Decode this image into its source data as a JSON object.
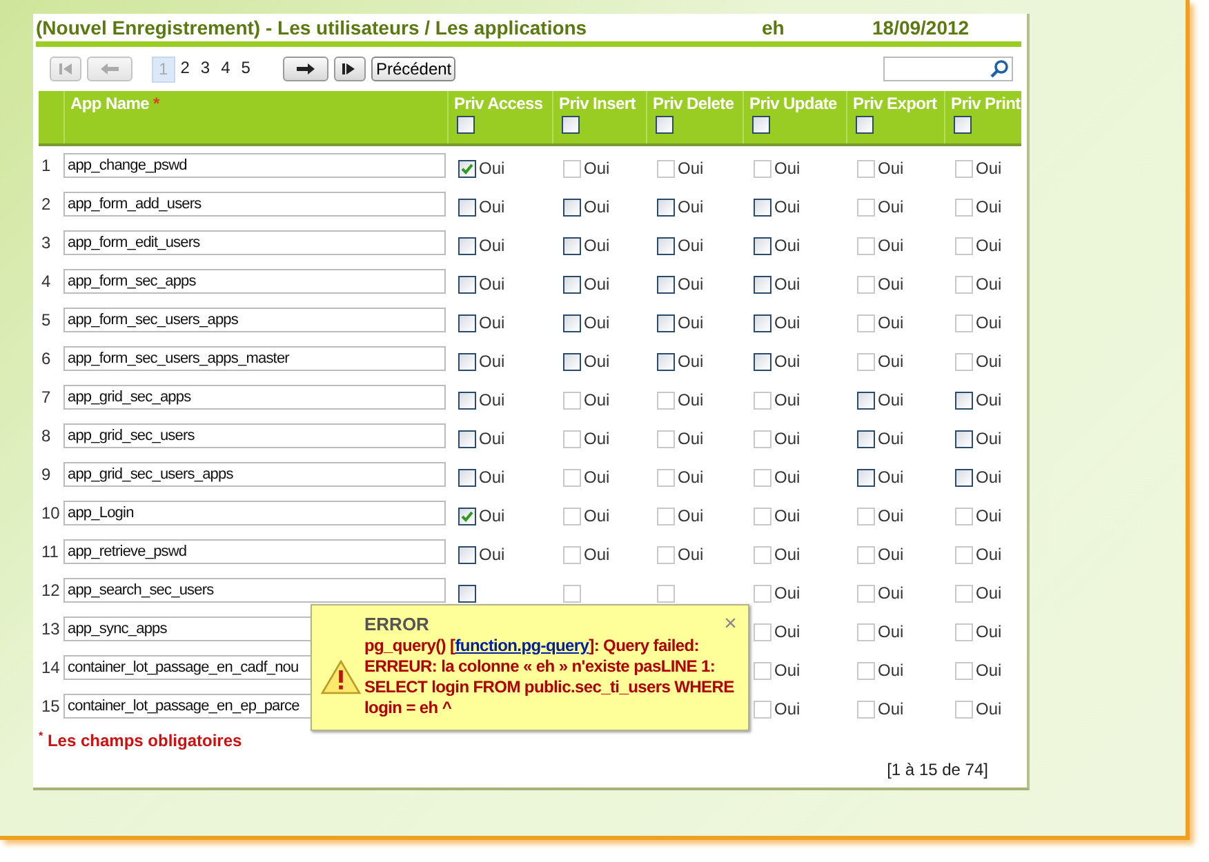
{
  "header": {
    "title": "(Nouvel Enregistrement) - Les utilisateurs / Les applications",
    "user": "eh",
    "date": "18/09/2012"
  },
  "pager": {
    "nav": [
      {
        "kind": "first",
        "disabled": true
      },
      {
        "kind": "prev",
        "disabled": true
      },
      {
        "kind": "pages"
      },
      {
        "kind": "next",
        "disabled": false
      },
      {
        "kind": "last",
        "disabled": false
      },
      {
        "kind": "back",
        "label": "Précédent"
      }
    ],
    "pages": [
      {
        "label": "1",
        "selected": true
      },
      {
        "label": "2",
        "selected": false
      },
      {
        "label": "3",
        "selected": false
      },
      {
        "label": "4",
        "selected": false
      },
      {
        "label": "5",
        "selected": false
      }
    ]
  },
  "table": {
    "columns": [
      {
        "label": "App Name",
        "marker": "*"
      },
      {
        "label": "Priv Access"
      },
      {
        "label": "Priv Insert"
      },
      {
        "label": "Priv Delete"
      },
      {
        "label": "Priv Update"
      },
      {
        "label": "Priv Export"
      },
      {
        "label": "Priv Print"
      }
    ],
    "header_checks": [
      {
        "checked": false
      },
      {
        "checked": false
      },
      {
        "checked": false
      },
      {
        "checked": false
      },
      {
        "checked": false
      },
      {
        "checked": false
      }
    ],
    "rows": [
      {
        "num": "1",
        "name": "app_change_pswd",
        "privs": [
          {
            "label": "Oui",
            "checked": true,
            "disabled": false
          },
          {
            "label": "Oui",
            "checked": false,
            "disabled": true
          },
          {
            "label": "Oui",
            "checked": false,
            "disabled": true
          },
          {
            "label": "Oui",
            "checked": false,
            "disabled": true
          },
          {
            "label": "Oui",
            "checked": false,
            "disabled": true
          },
          {
            "label": "Oui",
            "checked": false,
            "disabled": true
          }
        ]
      },
      {
        "num": "2",
        "name": "app_form_add_users",
        "privs": [
          {
            "label": "Oui",
            "checked": false,
            "disabled": false
          },
          {
            "label": "Oui",
            "checked": false,
            "disabled": false
          },
          {
            "label": "Oui",
            "checked": false,
            "disabled": false
          },
          {
            "label": "Oui",
            "checked": false,
            "disabled": false
          },
          {
            "label": "Oui",
            "checked": false,
            "disabled": true
          },
          {
            "label": "Oui",
            "checked": false,
            "disabled": true
          }
        ]
      },
      {
        "num": "3",
        "name": "app_form_edit_users",
        "privs": [
          {
            "label": "Oui",
            "checked": false,
            "disabled": false
          },
          {
            "label": "Oui",
            "checked": false,
            "disabled": false
          },
          {
            "label": "Oui",
            "checked": false,
            "disabled": false
          },
          {
            "label": "Oui",
            "checked": false,
            "disabled": false
          },
          {
            "label": "Oui",
            "checked": false,
            "disabled": true
          },
          {
            "label": "Oui",
            "checked": false,
            "disabled": true
          }
        ]
      },
      {
        "num": "4",
        "name": "app_form_sec_apps",
        "privs": [
          {
            "label": "Oui",
            "checked": false,
            "disabled": false
          },
          {
            "label": "Oui",
            "checked": false,
            "disabled": false
          },
          {
            "label": "Oui",
            "checked": false,
            "disabled": false
          },
          {
            "label": "Oui",
            "checked": false,
            "disabled": false
          },
          {
            "label": "Oui",
            "checked": false,
            "disabled": true
          },
          {
            "label": "Oui",
            "checked": false,
            "disabled": true
          }
        ]
      },
      {
        "num": "5",
        "name": "app_form_sec_users_apps",
        "privs": [
          {
            "label": "Oui",
            "checked": false,
            "disabled": false
          },
          {
            "label": "Oui",
            "checked": false,
            "disabled": false
          },
          {
            "label": "Oui",
            "checked": false,
            "disabled": false
          },
          {
            "label": "Oui",
            "checked": false,
            "disabled": false
          },
          {
            "label": "Oui",
            "checked": false,
            "disabled": true
          },
          {
            "label": "Oui",
            "checked": false,
            "disabled": true
          }
        ]
      },
      {
        "num": "6",
        "name": "app_form_sec_users_apps_master",
        "privs": [
          {
            "label": "Oui",
            "checked": false,
            "disabled": false
          },
          {
            "label": "Oui",
            "checked": false,
            "disabled": false
          },
          {
            "label": "Oui",
            "checked": false,
            "disabled": false
          },
          {
            "label": "Oui",
            "checked": false,
            "disabled": false
          },
          {
            "label": "Oui",
            "checked": false,
            "disabled": true
          },
          {
            "label": "Oui",
            "checked": false,
            "disabled": true
          }
        ]
      },
      {
        "num": "7",
        "name": "app_grid_sec_apps",
        "privs": [
          {
            "label": "Oui",
            "checked": false,
            "disabled": false
          },
          {
            "label": "Oui",
            "checked": false,
            "disabled": true
          },
          {
            "label": "Oui",
            "checked": false,
            "disabled": true
          },
          {
            "label": "Oui",
            "checked": false,
            "disabled": true
          },
          {
            "label": "Oui",
            "checked": false,
            "disabled": false
          },
          {
            "label": "Oui",
            "checked": false,
            "disabled": false
          }
        ]
      },
      {
        "num": "8",
        "name": "app_grid_sec_users",
        "privs": [
          {
            "label": "Oui",
            "checked": false,
            "disabled": false
          },
          {
            "label": "Oui",
            "checked": false,
            "disabled": true
          },
          {
            "label": "Oui",
            "checked": false,
            "disabled": true
          },
          {
            "label": "Oui",
            "checked": false,
            "disabled": true
          },
          {
            "label": "Oui",
            "checked": false,
            "disabled": false
          },
          {
            "label": "Oui",
            "checked": false,
            "disabled": false
          }
        ]
      },
      {
        "num": "9",
        "name": "app_grid_sec_users_apps",
        "privs": [
          {
            "label": "Oui",
            "checked": false,
            "disabled": false
          },
          {
            "label": "Oui",
            "checked": false,
            "disabled": true
          },
          {
            "label": "Oui",
            "checked": false,
            "disabled": true
          },
          {
            "label": "Oui",
            "checked": false,
            "disabled": true
          },
          {
            "label": "Oui",
            "checked": false,
            "disabled": false
          },
          {
            "label": "Oui",
            "checked": false,
            "disabled": false
          }
        ]
      },
      {
        "num": "10",
        "name": "app_Login",
        "privs": [
          {
            "label": "Oui",
            "checked": true,
            "disabled": false
          },
          {
            "label": "Oui",
            "checked": false,
            "disabled": true
          },
          {
            "label": "Oui",
            "checked": false,
            "disabled": true
          },
          {
            "label": "Oui",
            "checked": false,
            "disabled": true
          },
          {
            "label": "Oui",
            "checked": false,
            "disabled": true
          },
          {
            "label": "Oui",
            "checked": false,
            "disabled": true
          }
        ]
      },
      {
        "num": "11",
        "name": "app_retrieve_pswd",
        "privs": [
          {
            "label": "Oui",
            "checked": false,
            "disabled": false
          },
          {
            "label": "Oui",
            "checked": false,
            "disabled": true
          },
          {
            "label": "Oui",
            "checked": false,
            "disabled": true
          },
          {
            "label": "Oui",
            "checked": false,
            "disabled": true
          },
          {
            "label": "Oui",
            "checked": false,
            "disabled": true
          },
          {
            "label": "Oui",
            "checked": false,
            "disabled": true
          }
        ]
      },
      {
        "num": "12",
        "name": "app_search_sec_users",
        "privs": [
          {
            "checked": false,
            "disabled": false
          },
          {
            "checked": false,
            "disabled": true
          },
          {
            "checked": false,
            "disabled": true
          },
          {
            "label": "Oui",
            "checked": false,
            "disabled": true
          },
          {
            "label": "Oui",
            "checked": false,
            "disabled": true
          },
          {
            "label": "Oui",
            "checked": false,
            "disabled": true
          }
        ]
      },
      {
        "num": "13",
        "name": "app_sync_apps",
        "privs": [
          {
            "kind": "update",
            "label": "Oui",
            "checked": false,
            "disabled": true
          },
          {
            "kind": "export",
            "label": "Oui",
            "checked": false,
            "disabled": true
          },
          {
            "kind": "print",
            "label": "Oui",
            "checked": false,
            "disabled": true
          }
        ]
      },
      {
        "num": "14",
        "name": "container_lot_passage_en_cadf_nou",
        "privs": [
          {
            "kind": "update",
            "label": "Oui",
            "checked": false,
            "disabled": true
          },
          {
            "kind": "export",
            "label": "Oui",
            "checked": false,
            "disabled": true
          },
          {
            "kind": "print",
            "label": "Oui",
            "checked": false,
            "disabled": true
          }
        ]
      },
      {
        "num": "15",
        "name": "container_lot_passage_en_ep_parce",
        "privs": [
          {
            "kind": "update",
            "label": "Oui",
            "checked": false,
            "disabled": true
          },
          {
            "kind": "export",
            "label": "Oui",
            "checked": false,
            "disabled": true
          },
          {
            "kind": "print",
            "label": "Oui",
            "checked": false,
            "disabled": true
          }
        ]
      }
    ]
  },
  "required_note": "$^{*}$ Les champs obligatoires",
  "record_count": "[1 à 15 de 74]",
  "error": {
    "title": "ERROR",
    "close": "×",
    "before": "pg_query() [",
    "link": "function.pg-query",
    "after": "]: Query failed: ERREUR: la colonne « eh » n'existe pasLINE 1: SELECT login FROM public.sec_ti_users WHERE login = eh ^"
  }
}
